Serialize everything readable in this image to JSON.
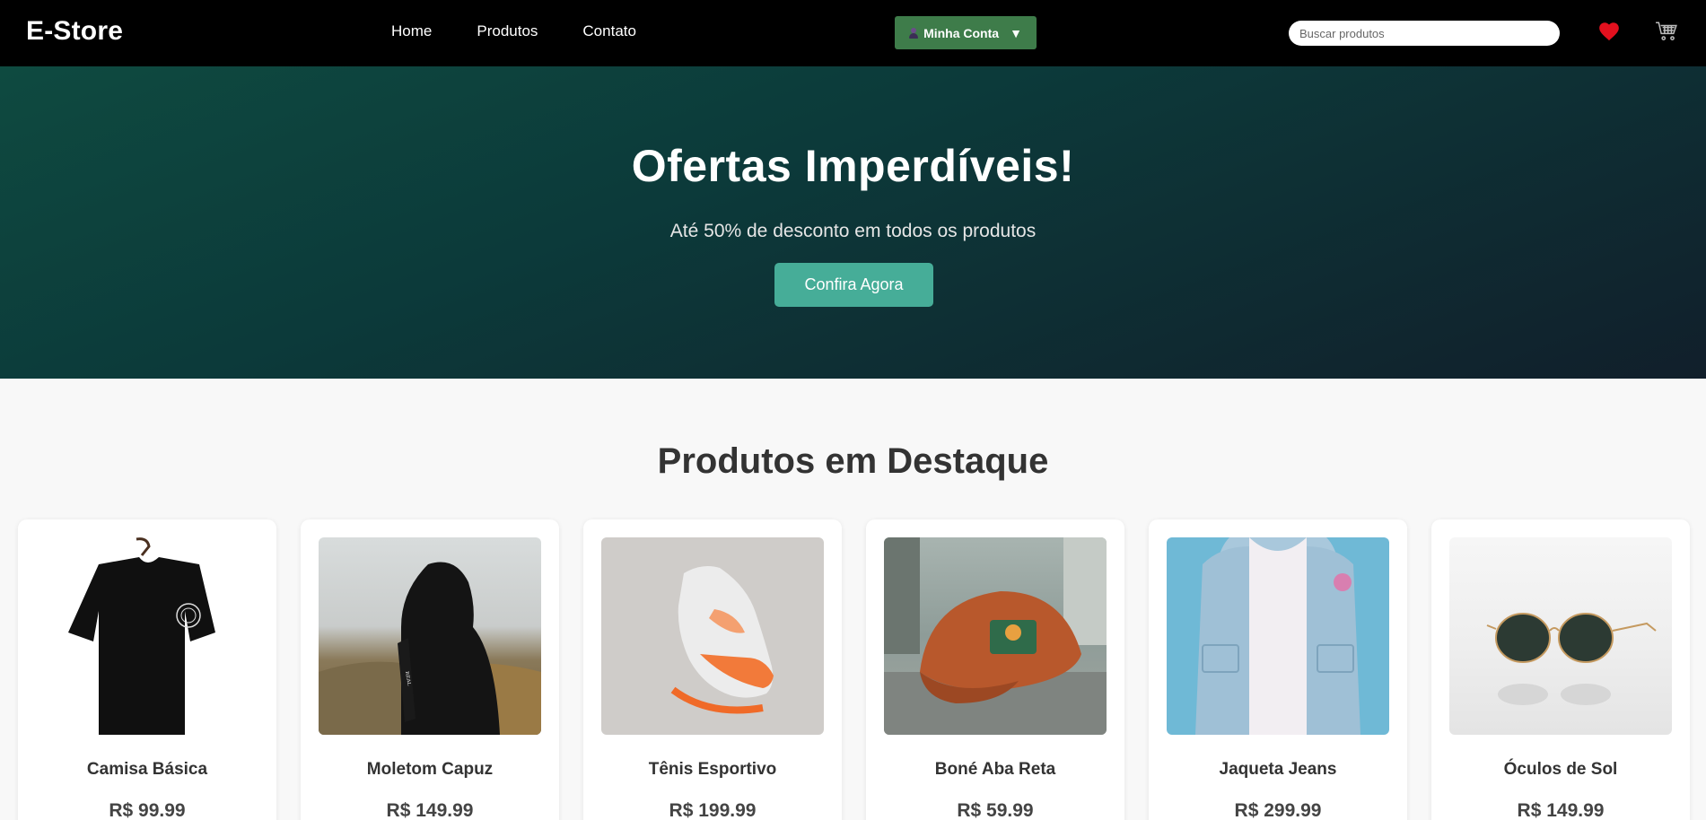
{
  "navbar": {
    "brand": "E-Store",
    "links": [
      "Home",
      "Produtos",
      "Contato"
    ],
    "account_label": "Minha Conta",
    "account_caret": "▼",
    "search_placeholder": "Buscar produtos",
    "icons": [
      "heart-icon",
      "cart-icon"
    ]
  },
  "hero": {
    "title": "Ofertas Imperdíveis!",
    "subtitle": "Até 50% de desconto em todos os produtos",
    "cta": "Confira Agora"
  },
  "featured": {
    "title": "Produtos em Destaque",
    "products": [
      {
        "name": "Camisa Básica",
        "price": "R$ 99.99"
      },
      {
        "name": "Moletom Capuz",
        "price": "R$ 149.99"
      },
      {
        "name": "Tênis Esportivo",
        "price": "R$ 199.99"
      },
      {
        "name": "Boné Aba Reta",
        "price": "R$ 59.99"
      },
      {
        "name": "Jaqueta Jeans",
        "price": "R$ 299.99"
      },
      {
        "name": "Óculos de Sol",
        "price": "R$ 149.99"
      }
    ]
  },
  "colors": {
    "navbar_bg": "#000000",
    "account_button": "#3e7c4a",
    "hero_start": "#0e4a40",
    "hero_end": "#111f2b",
    "cta": "#46ad98",
    "heart": "#e3101e"
  }
}
